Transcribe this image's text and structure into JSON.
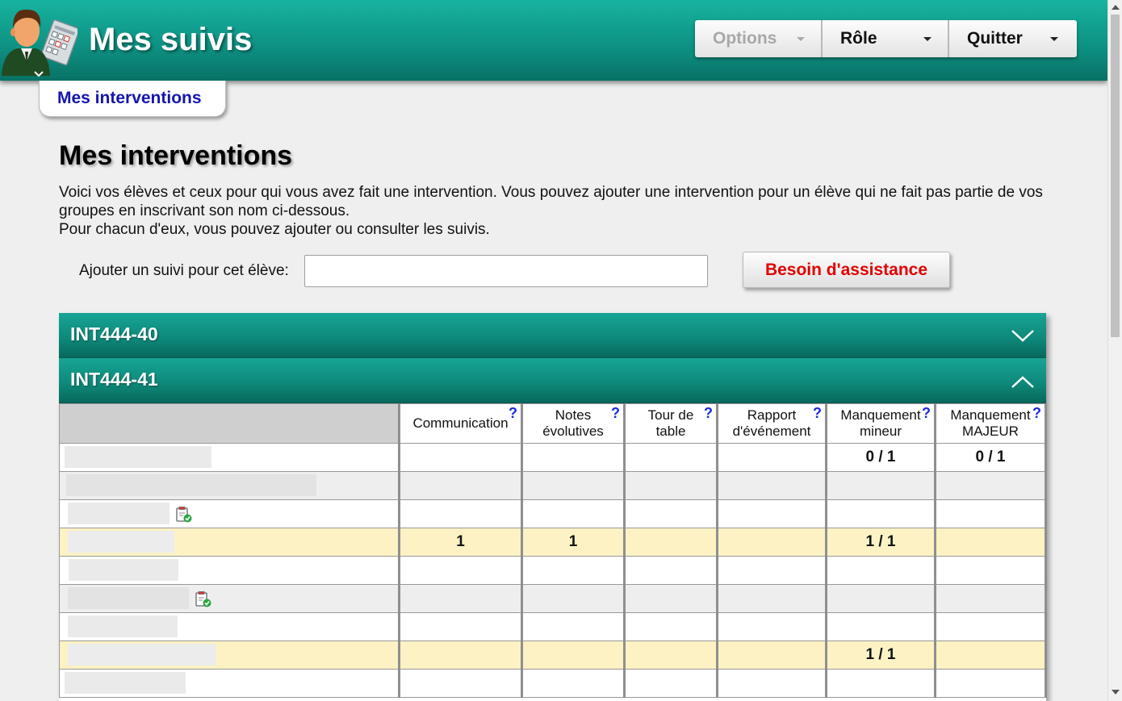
{
  "header": {
    "title": "Mes suivis",
    "menu": {
      "options_label": "Options",
      "role_label": "Rôle",
      "quit_label": "Quitter"
    }
  },
  "tab": {
    "label": "Mes interventions"
  },
  "main": {
    "title": "Mes interventions",
    "intro_line1": "Voici vos élèves et ceux pour qui vous avez fait une intervention. Vous pouvez ajouter une intervention pour un élève qui ne fait pas partie de vos groupes en inscrivant son nom ci-dessous.",
    "intro_line2": "Pour chacun d'eux, vous pouvez ajouter ou consulter les suivis.",
    "add_label": "Ajouter un suivi pour cet élève:",
    "add_input_value": "",
    "help_button": "Besoin d'assistance"
  },
  "groups": [
    {
      "name": "INT444-40",
      "expanded": false
    },
    {
      "name": "INT444-41",
      "expanded": true
    }
  ],
  "table": {
    "columns": [
      {
        "label": "Communication",
        "help": "?"
      },
      {
        "label_line1": "Notes",
        "label_line2": "évolutives",
        "help": "?"
      },
      {
        "label_line1": "Tour de",
        "label_line2": "table",
        "help": "?"
      },
      {
        "label_line1": "Rapport",
        "label_line2": "d'événement",
        "help": "?"
      },
      {
        "label_line1": "Manquement",
        "label_line2": "mineur",
        "help": "?"
      },
      {
        "label_line1": "Manquement",
        "label_line2": "MAJEUR",
        "help": "?"
      }
    ],
    "rows": [
      {
        "style": "white",
        "cells": [
          "",
          "",
          "",
          "",
          "0 / 1",
          "0 / 1"
        ]
      },
      {
        "style": "grey",
        "cells": [
          "",
          "",
          "",
          "",
          "",
          ""
        ]
      },
      {
        "style": "white",
        "cells": [
          "",
          "",
          "",
          "",
          "",
          ""
        ]
      },
      {
        "style": "yellow",
        "cells": [
          "1",
          "1",
          "",
          "",
          "1 / 1",
          ""
        ]
      },
      {
        "style": "white",
        "cells": [
          "",
          "",
          "",
          "",
          "",
          ""
        ]
      },
      {
        "style": "grey",
        "cells": [
          "",
          "",
          "",
          "",
          "",
          ""
        ]
      },
      {
        "style": "white",
        "cells": [
          "",
          "",
          "",
          "",
          "",
          ""
        ]
      },
      {
        "style": "yellow",
        "cells": [
          "",
          "",
          "",
          "",
          "1 / 1",
          ""
        ]
      },
      {
        "style": "white",
        "cells": [
          "",
          "",
          "",
          "",
          "",
          ""
        ]
      }
    ]
  },
  "colors": {
    "header_teal": "#0e9384",
    "accent_blue": "#1515b0",
    "alert_red": "#e00000",
    "highlight_yellow": "#fdf2c4"
  }
}
